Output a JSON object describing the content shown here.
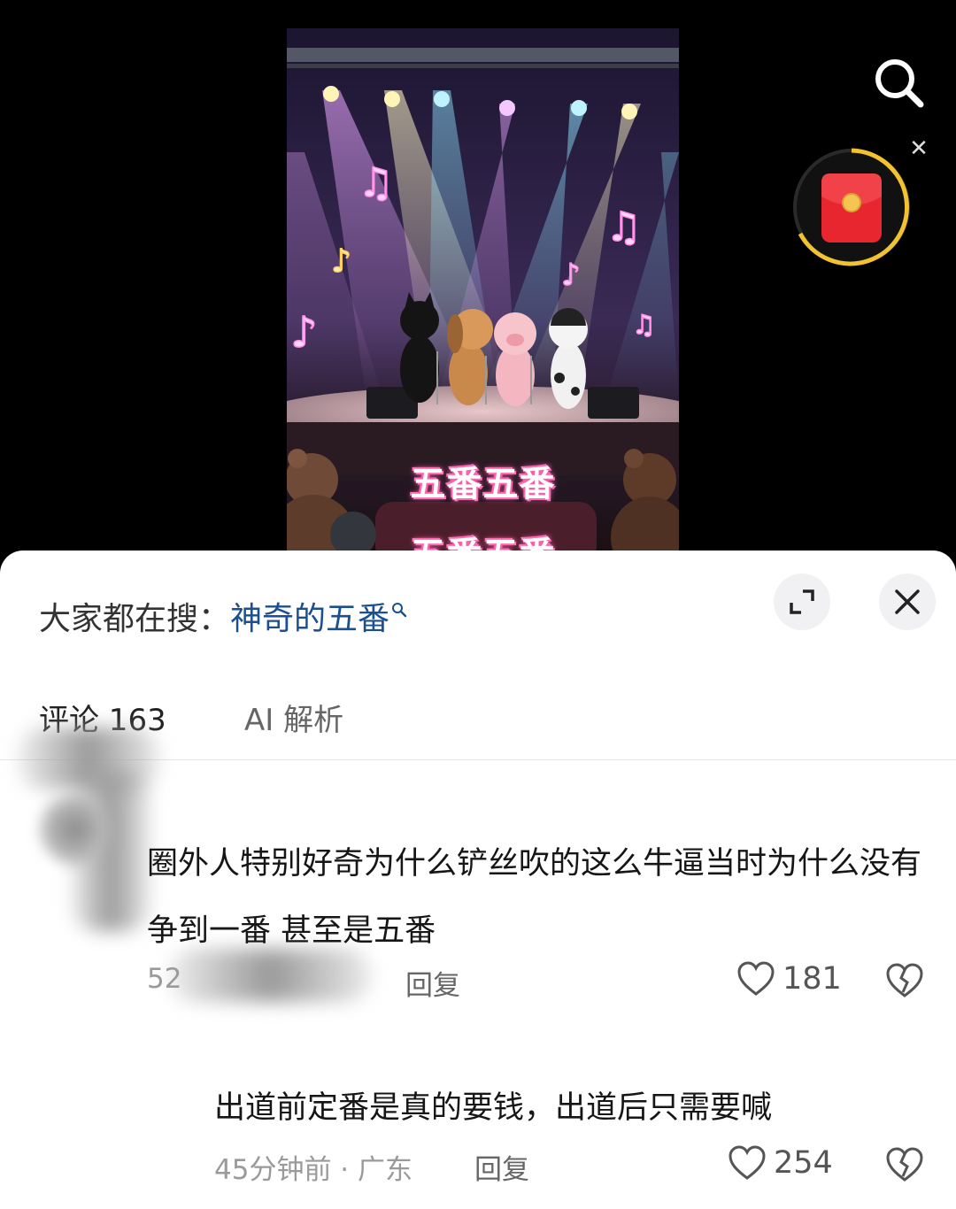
{
  "video": {
    "caption_lines": [
      "五番五番",
      "五番五番"
    ]
  },
  "search_hint": {
    "prefix": "大家都在搜：",
    "term": "神奇的五番"
  },
  "tabs": {
    "comments_label": "评论 163",
    "ai_label": "AI 解析"
  },
  "comments": [
    {
      "text": "圈外人特别好奇为什么铲丝吹的这么牛逼当时为什么没有争到一番 甚至是五番",
      "meta_visible": "52",
      "reply_label": "回复",
      "likes": "181"
    },
    {
      "text": "出道前定番是真的要钱，出道后只需要喊",
      "meta_visible": "45分钟前 · 广东",
      "reply_label": "回复",
      "likes": "254"
    }
  ],
  "icons": {
    "search": "search-icon",
    "close": "close-icon",
    "expand": "expand-icon",
    "heart": "heart-icon",
    "broken_heart": "broken-heart-icon",
    "red_packet": "red-packet-icon"
  },
  "colors": {
    "search_term": "#1c4f8f",
    "red_packet": "#e8262f",
    "timer_ring": "#f2c230"
  }
}
